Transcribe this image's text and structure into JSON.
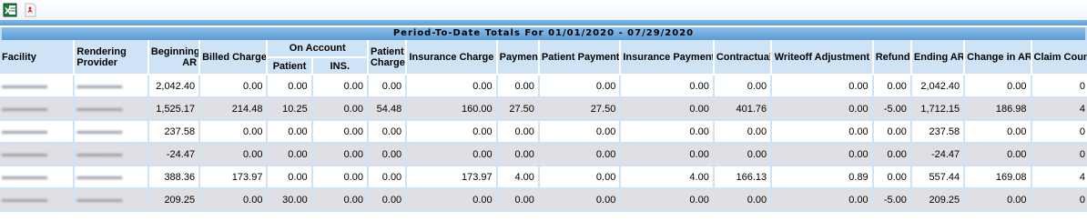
{
  "report_title": "Period-To-Date Totals For 01/01/2020 - 07/29/2020",
  "headers": {
    "facility": "Facility",
    "rendering_provider": "Rendering Provider",
    "beginning_ar": "Beginning AR",
    "billed_charge": "Billed Charge",
    "on_account": "On Account",
    "on_account_patient": "Patient",
    "on_account_ins": "INS.",
    "patient_charge": "Patient Charge",
    "insurance_charge": "Insurance Charge",
    "payment": "Payment",
    "patient_payment": "Patient Payment",
    "insurance_payment": "Insurance Payment",
    "contractual": "Contractual",
    "writeoff_adjustment": "Writeoff Adjustment",
    "refund": "Refund",
    "ending_ar": "Ending AR",
    "change_in_ar": "Change in AR",
    "claim_count": "Claim Count"
  },
  "rows": [
    {
      "beginning_ar": "2,042.40",
      "billed_charge": "0.00",
      "on_account_patient": "0.00",
      "on_account_ins": "0.00",
      "patient_charge": "0.00",
      "insurance_charge": "0.00",
      "payment": "0.00",
      "patient_payment": "0.00",
      "insurance_payment": "0.00",
      "contractual": "0.00",
      "writeoff_adjustment": "0.00",
      "refund": "0.00",
      "ending_ar": "2,042.40",
      "change_in_ar": "0.00",
      "claim_count": "0"
    },
    {
      "beginning_ar": "1,525.17",
      "billed_charge": "214.48",
      "on_account_patient": "10.25",
      "on_account_ins": "0.00",
      "patient_charge": "54.48",
      "insurance_charge": "160.00",
      "payment": "27.50",
      "patient_payment": "27.50",
      "insurance_payment": "0.00",
      "contractual": "401.76",
      "writeoff_adjustment": "0.00",
      "refund": "-5.00",
      "ending_ar": "1,712.15",
      "change_in_ar": "186.98",
      "claim_count": "4"
    },
    {
      "beginning_ar": "237.58",
      "billed_charge": "0.00",
      "on_account_patient": "0.00",
      "on_account_ins": "0.00",
      "patient_charge": "0.00",
      "insurance_charge": "0.00",
      "payment": "0.00",
      "patient_payment": "0.00",
      "insurance_payment": "0.00",
      "contractual": "0.00",
      "writeoff_adjustment": "0.00",
      "refund": "0.00",
      "ending_ar": "237.58",
      "change_in_ar": "0.00",
      "claim_count": "0"
    },
    {
      "beginning_ar": "-24.47",
      "billed_charge": "0.00",
      "on_account_patient": "0.00",
      "on_account_ins": "0.00",
      "patient_charge": "0.00",
      "insurance_charge": "0.00",
      "payment": "0.00",
      "patient_payment": "0.00",
      "insurance_payment": "0.00",
      "contractual": "0.00",
      "writeoff_adjustment": "0.00",
      "refund": "0.00",
      "ending_ar": "-24.47",
      "change_in_ar": "0.00",
      "claim_count": "0"
    },
    {
      "beginning_ar": "388.36",
      "billed_charge": "173.97",
      "on_account_patient": "0.00",
      "on_account_ins": "0.00",
      "patient_charge": "0.00",
      "insurance_charge": "173.97",
      "payment": "4.00",
      "patient_payment": "0.00",
      "insurance_payment": "4.00",
      "contractual": "166.13",
      "writeoff_adjustment": "0.89",
      "refund": "0.00",
      "ending_ar": "557.44",
      "change_in_ar": "169.08",
      "claim_count": "4"
    },
    {
      "beginning_ar": "209.25",
      "billed_charge": "0.00",
      "on_account_patient": "30.00",
      "on_account_ins": "0.00",
      "patient_charge": "0.00",
      "insurance_charge": "0.00",
      "payment": "0.00",
      "patient_payment": "0.00",
      "insurance_payment": "0.00",
      "contractual": "0.00",
      "writeoff_adjustment": "0.00",
      "refund": "-5.00",
      "ending_ar": "209.25",
      "change_in_ar": "0.00",
      "claim_count": "0"
    }
  ],
  "colors": {
    "header_bg": "#cfe3f6",
    "title_bar": "#5a9ad6",
    "row_alt": "#dfdfe4"
  },
  "icons": {
    "excel": "excel-export-icon",
    "pdf": "pdf-export-icon"
  }
}
